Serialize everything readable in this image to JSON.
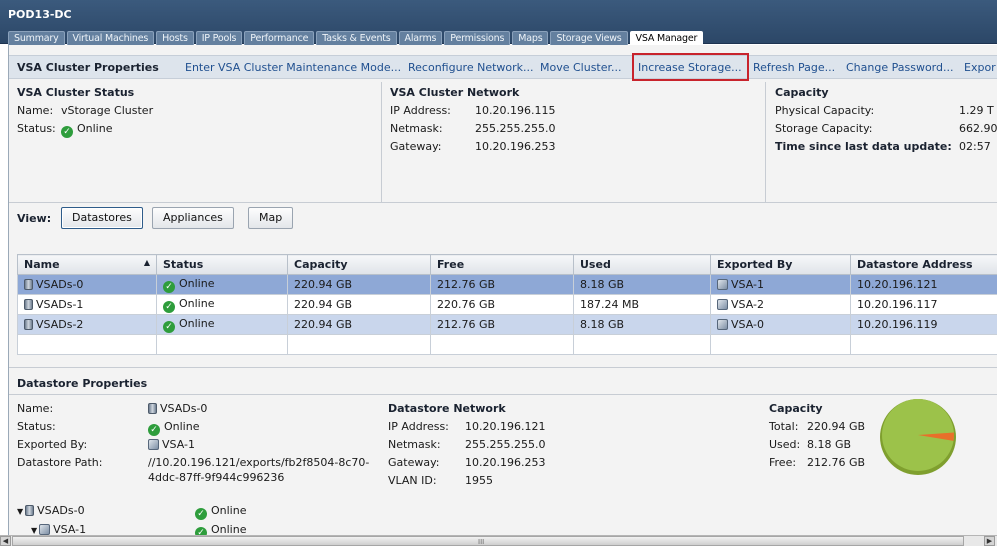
{
  "header": {
    "title": "POD13-DC",
    "tabs": [
      "Summary",
      "Virtual Machines",
      "Hosts",
      "IP Pools",
      "Performance",
      "Tasks & Events",
      "Alarms",
      "Permissions",
      "Maps",
      "Storage Views",
      "VSA Manager"
    ],
    "active_tab": "VSA Manager"
  },
  "toolbar": {
    "title": "VSA Cluster Properties",
    "links": [
      "Enter VSA Cluster Maintenance Mode...",
      "Reconfigure Network...",
      "Move Cluster...",
      "Increase Storage...",
      "Refresh Page...",
      "Change Password...",
      "Expor"
    ]
  },
  "cluster_status": {
    "title": "VSA Cluster Status",
    "name_label": "Name:",
    "name_value": "vStorage Cluster",
    "status_label": "Status:",
    "status_value": "Online"
  },
  "cluster_network": {
    "title": "VSA Cluster Network",
    "ip_label": "IP Address:",
    "ip_value": "10.20.196.115",
    "netmask_label": "Netmask:",
    "netmask_value": "255.255.255.0",
    "gateway_label": "Gateway:",
    "gateway_value": "10.20.196.253"
  },
  "capacity": {
    "title": "Capacity",
    "physical_label": "Physical Capacity:",
    "physical_value": "1.29 T",
    "storage_label": "Storage Capacity:",
    "storage_value": "662.90",
    "update_label": "Time since last data update:",
    "update_value": "02:57"
  },
  "view": {
    "label": "View:",
    "buttons": [
      "Datastores",
      "Appliances",
      "Map"
    ],
    "active": "Datastores"
  },
  "table": {
    "columns": [
      "Name",
      "Status",
      "Capacity",
      "Free",
      "Used",
      "Exported By",
      "Datastore Address"
    ],
    "sort_indicator": "▲",
    "rows": [
      {
        "name": "VSADs-0",
        "status": "Online",
        "capacity": "220.94 GB",
        "free": "212.76 GB",
        "used": "8.18 GB",
        "exported_by": "VSA-1",
        "address": "10.20.196.121"
      },
      {
        "name": "VSADs-1",
        "status": "Online",
        "capacity": "220.94 GB",
        "free": "220.76 GB",
        "used": "187.24 MB",
        "exported_by": "VSA-2",
        "address": "10.20.196.117"
      },
      {
        "name": "VSADs-2",
        "status": "Online",
        "capacity": "220.94 GB",
        "free": "212.76 GB",
        "used": "8.18 GB",
        "exported_by": "VSA-0",
        "address": "10.20.196.119"
      }
    ]
  },
  "ds_props": {
    "title": "Datastore Properties",
    "name_label": "Name:",
    "name_value": "VSADs-0",
    "status_label": "Status:",
    "status_value": "Online",
    "exported_label": "Exported By:",
    "exported_value": "VSA-1",
    "path_label": "Datastore Path:",
    "path_line1": "//10.20.196.121/exports/fb2f8504-8c70-",
    "path_line2": "4ddc-87ff-9f944c996236",
    "network_title": "Datastore Network",
    "ip_label": "IP Address:",
    "ip_value": "10.20.196.121",
    "netmask_label": "Netmask:",
    "netmask_value": "255.255.255.0",
    "gateway_label": "Gateway:",
    "gateway_value": "10.20.196.253",
    "vlan_label": "VLAN ID:",
    "vlan_value": "1955",
    "capacity_title": "Capacity",
    "total_label": "Total:",
    "total_value": "220.94 GB",
    "used_label": "Used:",
    "used_value": "8.18 GB",
    "free_label": "Free:",
    "free_value": "212.76 GB",
    "pie_free_color": "#8db33a",
    "pie_used_color": "#e8702a"
  },
  "tree": {
    "root_name": "VSADs-0",
    "root_status": "Online",
    "child_name": "VSA-1",
    "child_status": "Online"
  },
  "scrollbar": {
    "left_arrow": "◀",
    "right_arrow": "▶",
    "grip": "III"
  }
}
